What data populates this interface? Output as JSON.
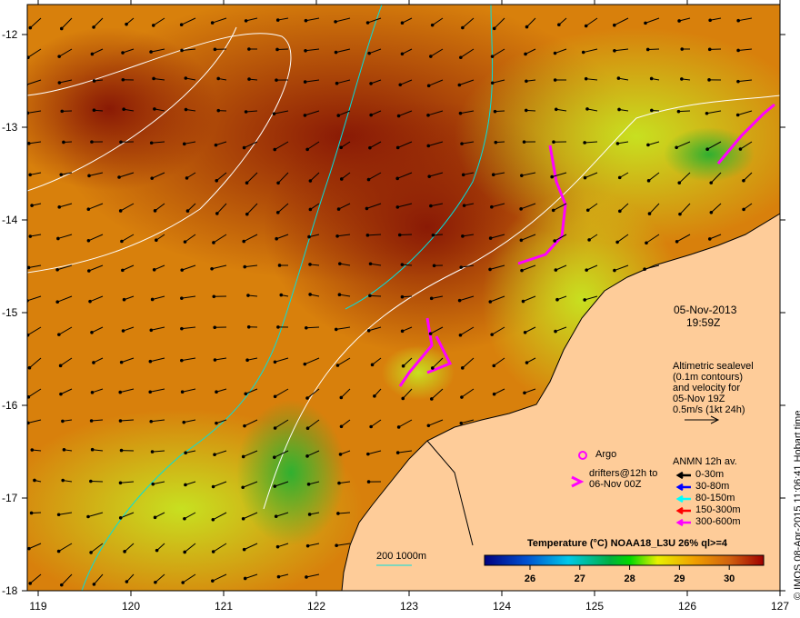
{
  "map": {
    "x_ticks": [
      "119",
      "120",
      "121",
      "122",
      "123",
      "124",
      "125",
      "126",
      "127"
    ],
    "y_ticks": [
      "-12",
      "-13",
      "-14",
      "-15",
      "-16",
      "-17",
      "-18"
    ],
    "date": "05-Nov-2013",
    "time": "19:59Z",
    "altimetry_note": [
      "Altimetric sealevel",
      "(0.1m contours)",
      "and velocity for",
      "05-Nov 19Z",
      "0.5m/s (1kt 24h)"
    ],
    "argo_label": "Argo",
    "drifters_label": [
      "drifters@12h to",
      "06-Nov 00Z"
    ],
    "anmn": {
      "title": "ANMN 12h av.",
      "items": [
        {
          "label": "0-30m",
          "color": "#000000"
        },
        {
          "label": "30-80m",
          "color": "#0000ff"
        },
        {
          "label": "80-150m",
          "color": "#00ffff"
        },
        {
          "label": "150-300m",
          "color": "#ff0000"
        },
        {
          "label": "300-600m",
          "color": "#ff00ff"
        }
      ]
    },
    "depth_scale_label": "200  1000m",
    "colorbar": {
      "title": "Temperature (°C) NOAA18_L3U 26% ql>=4",
      "ticks": [
        "26",
        "27",
        "28",
        "29",
        "30"
      ]
    },
    "credit": "© IMOS 08-Apr-2015 11:06:41  Hobart time",
    "colors": {
      "land": "#fecc99",
      "warm": "#c04a08",
      "accent": "#ff00ff",
      "contour_200m": "#00e0e0"
    }
  }
}
